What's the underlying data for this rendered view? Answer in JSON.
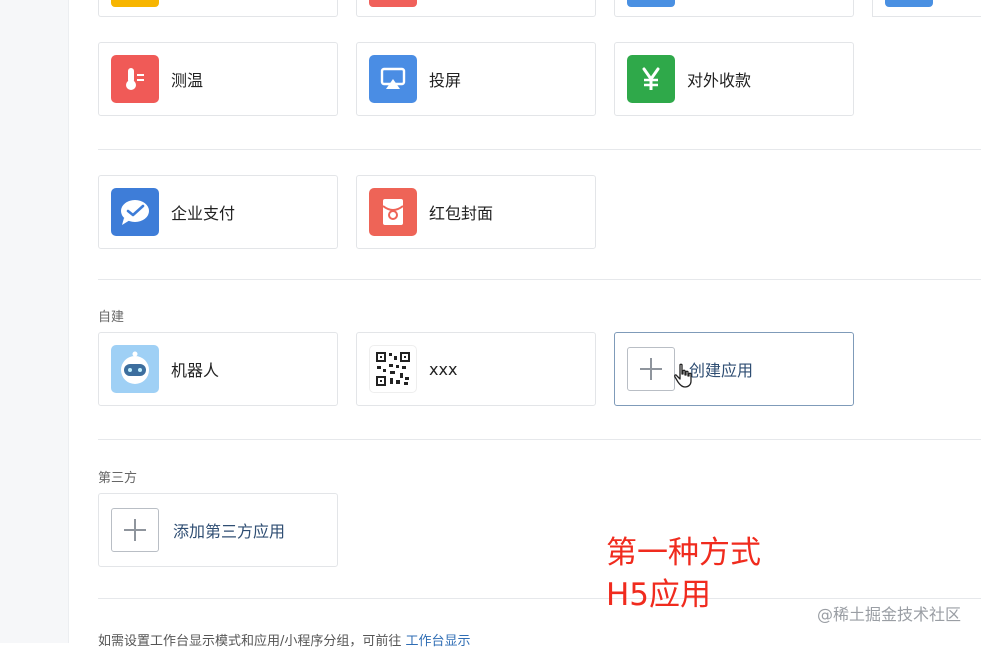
{
  "top_row": [
    {
      "color": "#f7b500"
    },
    {
      "color": "#f0605a"
    },
    {
      "color": "#4a90e2"
    },
    {
      "color": "#4a90e2"
    }
  ],
  "row1": [
    {
      "label": "测温",
      "icon": "thermometer-icon",
      "color": "#f05a57"
    },
    {
      "label": "投屏",
      "icon": "screen-cast-icon",
      "color": "#4a8de4"
    },
    {
      "label": "对外收款",
      "icon": "yen-icon",
      "color": "#2fa94a"
    }
  ],
  "row2": [
    {
      "label": "企业支付",
      "icon": "wecom-pay-icon",
      "color": "#3e7dd8"
    },
    {
      "label": "红包封面",
      "icon": "red-packet-icon",
      "color": "#ee6457"
    }
  ],
  "self_built": {
    "title": "自建",
    "apps": [
      {
        "label": "机器人",
        "icon": "robot-icon"
      },
      {
        "label": "xxx",
        "icon": "qrcode-icon"
      }
    ],
    "create_label": "创建应用"
  },
  "third_party": {
    "title": "第三方",
    "add_label": "添加第三方应用"
  },
  "annotation": {
    "line1": "第一种方式",
    "line2": "H5应用"
  },
  "watermark": "@稀土掘金技术社区",
  "footer": {
    "text": "如需设置工作台显示模式和应用/小程序分组，可前往",
    "link": "工作台显示"
  }
}
